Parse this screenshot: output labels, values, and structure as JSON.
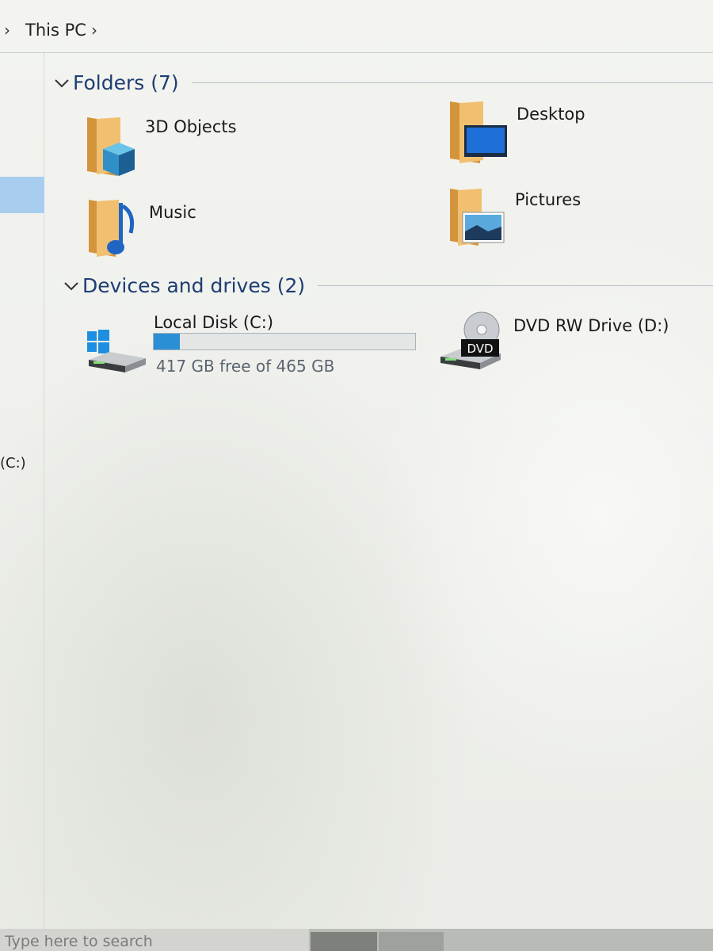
{
  "address_bar": {
    "location": "This PC"
  },
  "nav_pane": {
    "partial_label": "(C:)"
  },
  "folders_group": {
    "title": "Folders (7)",
    "items": [
      {
        "label": "3D Objects",
        "icon": "3d-objects-folder-icon"
      },
      {
        "label": "Desktop",
        "icon": "desktop-folder-icon"
      },
      {
        "label": "Music",
        "icon": "music-folder-icon"
      },
      {
        "label": "Pictures",
        "icon": "pictures-folder-icon"
      }
    ]
  },
  "devices_group": {
    "title": "Devices and drives (2)",
    "drives": [
      {
        "label": "Local Disk (C:)",
        "icon": "windows-drive-icon",
        "free_text": "417 GB free of 465 GB",
        "used_fraction": 0.1
      },
      {
        "label": "DVD RW Drive (D:)",
        "icon": "dvd-drive-icon",
        "badge": "DVD"
      }
    ]
  },
  "taskbar": {
    "search_placeholder": "Type here to search"
  },
  "colors": {
    "group_header": "#1e3d72",
    "selection": "#a9cdee",
    "usage_fill": "#2b8fd6",
    "folder": "#e3ac5c"
  }
}
